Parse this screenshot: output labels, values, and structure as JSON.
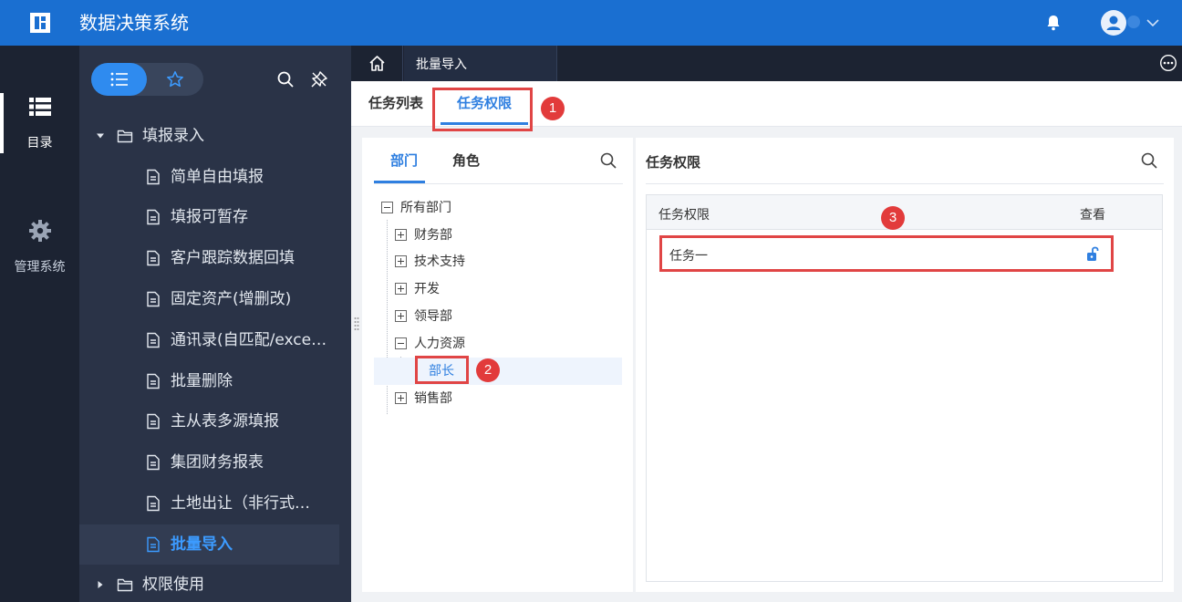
{
  "app": {
    "title": "数据决策系统"
  },
  "rail": {
    "catalog_label": "目录",
    "admin_label": "管理系统"
  },
  "nav": {
    "folders": [
      {
        "label": "填报录入",
        "expanded": true
      },
      {
        "label": "权限使用",
        "expanded": false
      }
    ],
    "items": [
      {
        "label": "简单自由填报"
      },
      {
        "label": "填报可暂存"
      },
      {
        "label": "客户跟踪数据回填"
      },
      {
        "label": "固定资产(增删改)"
      },
      {
        "label": "通讯录(自匹配/exce…"
      },
      {
        "label": "批量删除"
      },
      {
        "label": "主从表多源填报"
      },
      {
        "label": "集团财务报表"
      },
      {
        "label": "土地出让（非行式…"
      },
      {
        "label": "批量导入"
      }
    ]
  },
  "tabs": {
    "open_doc": "批量导入"
  },
  "subtabs": {
    "task_list": "任务列表",
    "task_permission": "任务权限"
  },
  "left_panel": {
    "tab_department": "部门",
    "tab_role": "角色",
    "tree": {
      "root": "所有部门",
      "children": [
        "财务部",
        "技术支持",
        "开发",
        "领导部",
        "人力资源"
      ],
      "hr_child": "部长",
      "last": "销售部"
    }
  },
  "right_panel": {
    "title": "任务权限",
    "col_permission": "任务权限",
    "col_view": "查看",
    "row_task": "任务一"
  },
  "annotations": [
    "1",
    "2",
    "3"
  ],
  "colors": {
    "topbar": "#1a6fd1",
    "accent": "#2f7fe0",
    "nav_bg": "#2a3347",
    "rail_bg": "#1c2332",
    "annotation": "#e04545"
  }
}
